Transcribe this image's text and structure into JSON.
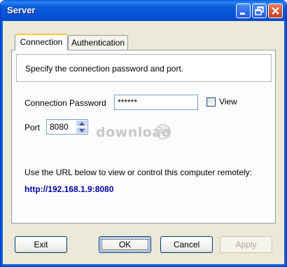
{
  "window": {
    "title": "Server"
  },
  "tabs": [
    {
      "label": "Connection",
      "active": true
    },
    {
      "label": "Authentication",
      "active": false
    }
  ],
  "connection": {
    "info_text": "Specify the connection password and port.",
    "password_label": "Connection Password",
    "password_value": "******",
    "view_label": "View",
    "view_checked": false,
    "port_label": "Port",
    "port_value": "8080",
    "watermark_text": "download",
    "watermark_badge": "3k",
    "url_caption": "Use the URL below to view or control this computer remotely:",
    "url": "http://192.168.1.9:8080"
  },
  "buttons": {
    "exit": "Exit",
    "ok": "OK",
    "cancel": "Cancel",
    "apply": "Apply"
  },
  "colors": {
    "titlebar": "#0a5fd9",
    "dialog_bg": "#ece9d8",
    "url_text": "#0000a8",
    "active_tab_accent": "#ffc83c"
  }
}
